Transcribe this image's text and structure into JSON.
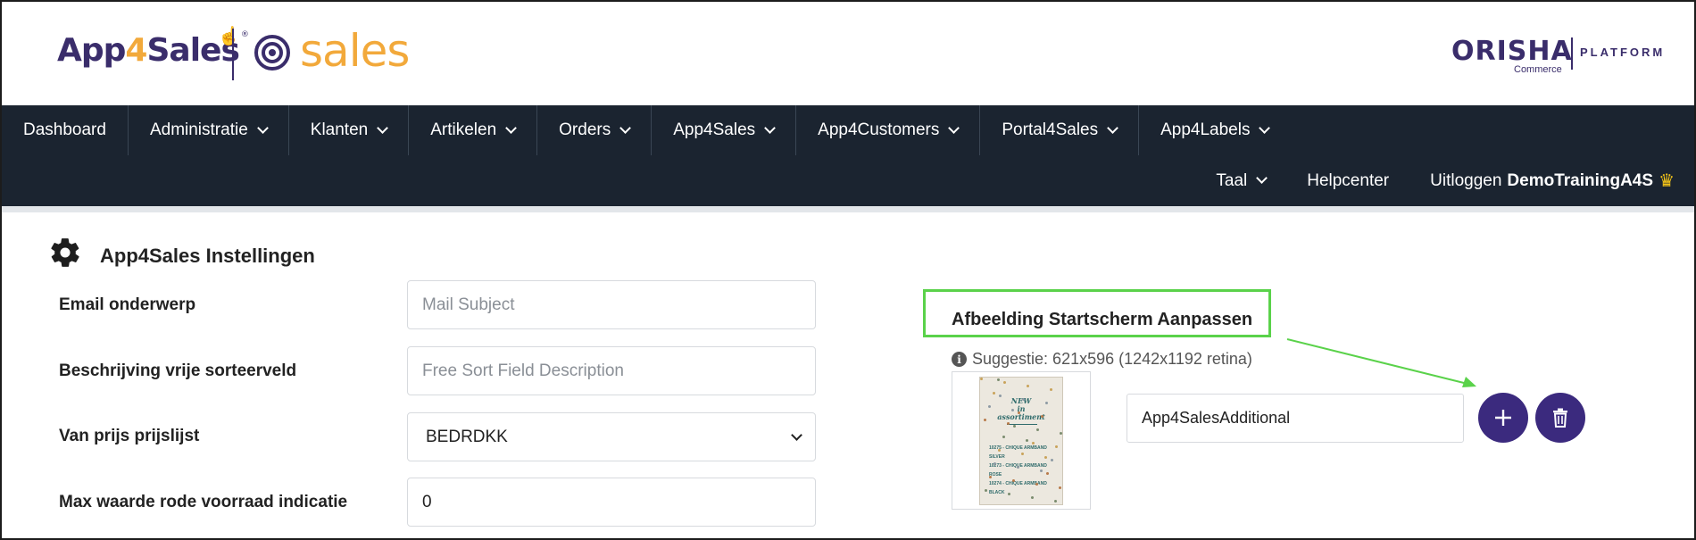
{
  "header": {
    "logo_app": "App",
    "logo_four": "4",
    "logo_sales_word": "Sales",
    "logo_reg": "®",
    "logo_sales": "sales",
    "orisha_word": "ORISHA",
    "orisha_sub": "Commerce",
    "orisha_platform": "PLATFORM"
  },
  "nav": {
    "items": [
      {
        "label": "Dashboard",
        "dropdown": false
      },
      {
        "label": "Administratie",
        "dropdown": true
      },
      {
        "label": "Klanten",
        "dropdown": true
      },
      {
        "label": "Artikelen",
        "dropdown": true
      },
      {
        "label": "Orders",
        "dropdown": true
      },
      {
        "label": "App4Sales",
        "dropdown": true
      },
      {
        "label": "App4Customers",
        "dropdown": true
      },
      {
        "label": "Portal4Sales",
        "dropdown": true
      },
      {
        "label": "App4Labels",
        "dropdown": true
      }
    ],
    "secondary": {
      "taal": "Taal",
      "helpcenter": "Helpcenter",
      "logout": "Uitloggen",
      "user": "DemoTrainingA4S"
    }
  },
  "settings": {
    "title": "App4Sales Instellingen",
    "email_label": "Email onderwerp",
    "email_placeholder": "Mail Subject",
    "sort_label": "Beschrijving vrije sorteerveld",
    "sort_placeholder": "Free Sort Field Description",
    "pricelist_label": "Van prijs prijslijst",
    "pricelist_value": "BEDRDKK",
    "stock_label": "Max waarde rode voorraad indicatie",
    "stock_value": "0"
  },
  "image_panel": {
    "title": "Afbeelding Startscherm Aanpassen",
    "hint": "Suggestie: 621x596 (1242x1192 retina)",
    "thumb_new": "NEW",
    "thumb_in": "in",
    "thumb_assortment": "assortiment",
    "thumb_line1": "10275 - CHIQUE ARMBAND SILVER",
    "thumb_line2": "10273 - CHIQUE ARMBAND ROSE",
    "thumb_line3": "10274 - CHIQUE ARMBAND BLACK",
    "file_name": "App4SalesAdditional"
  },
  "colors": {
    "nav_bg": "#1b2430",
    "brand_purple": "#3a2d6b",
    "brand_orange": "#f2a93b",
    "button_purple": "#3b2a7e",
    "highlight_green": "#5ad24a"
  }
}
